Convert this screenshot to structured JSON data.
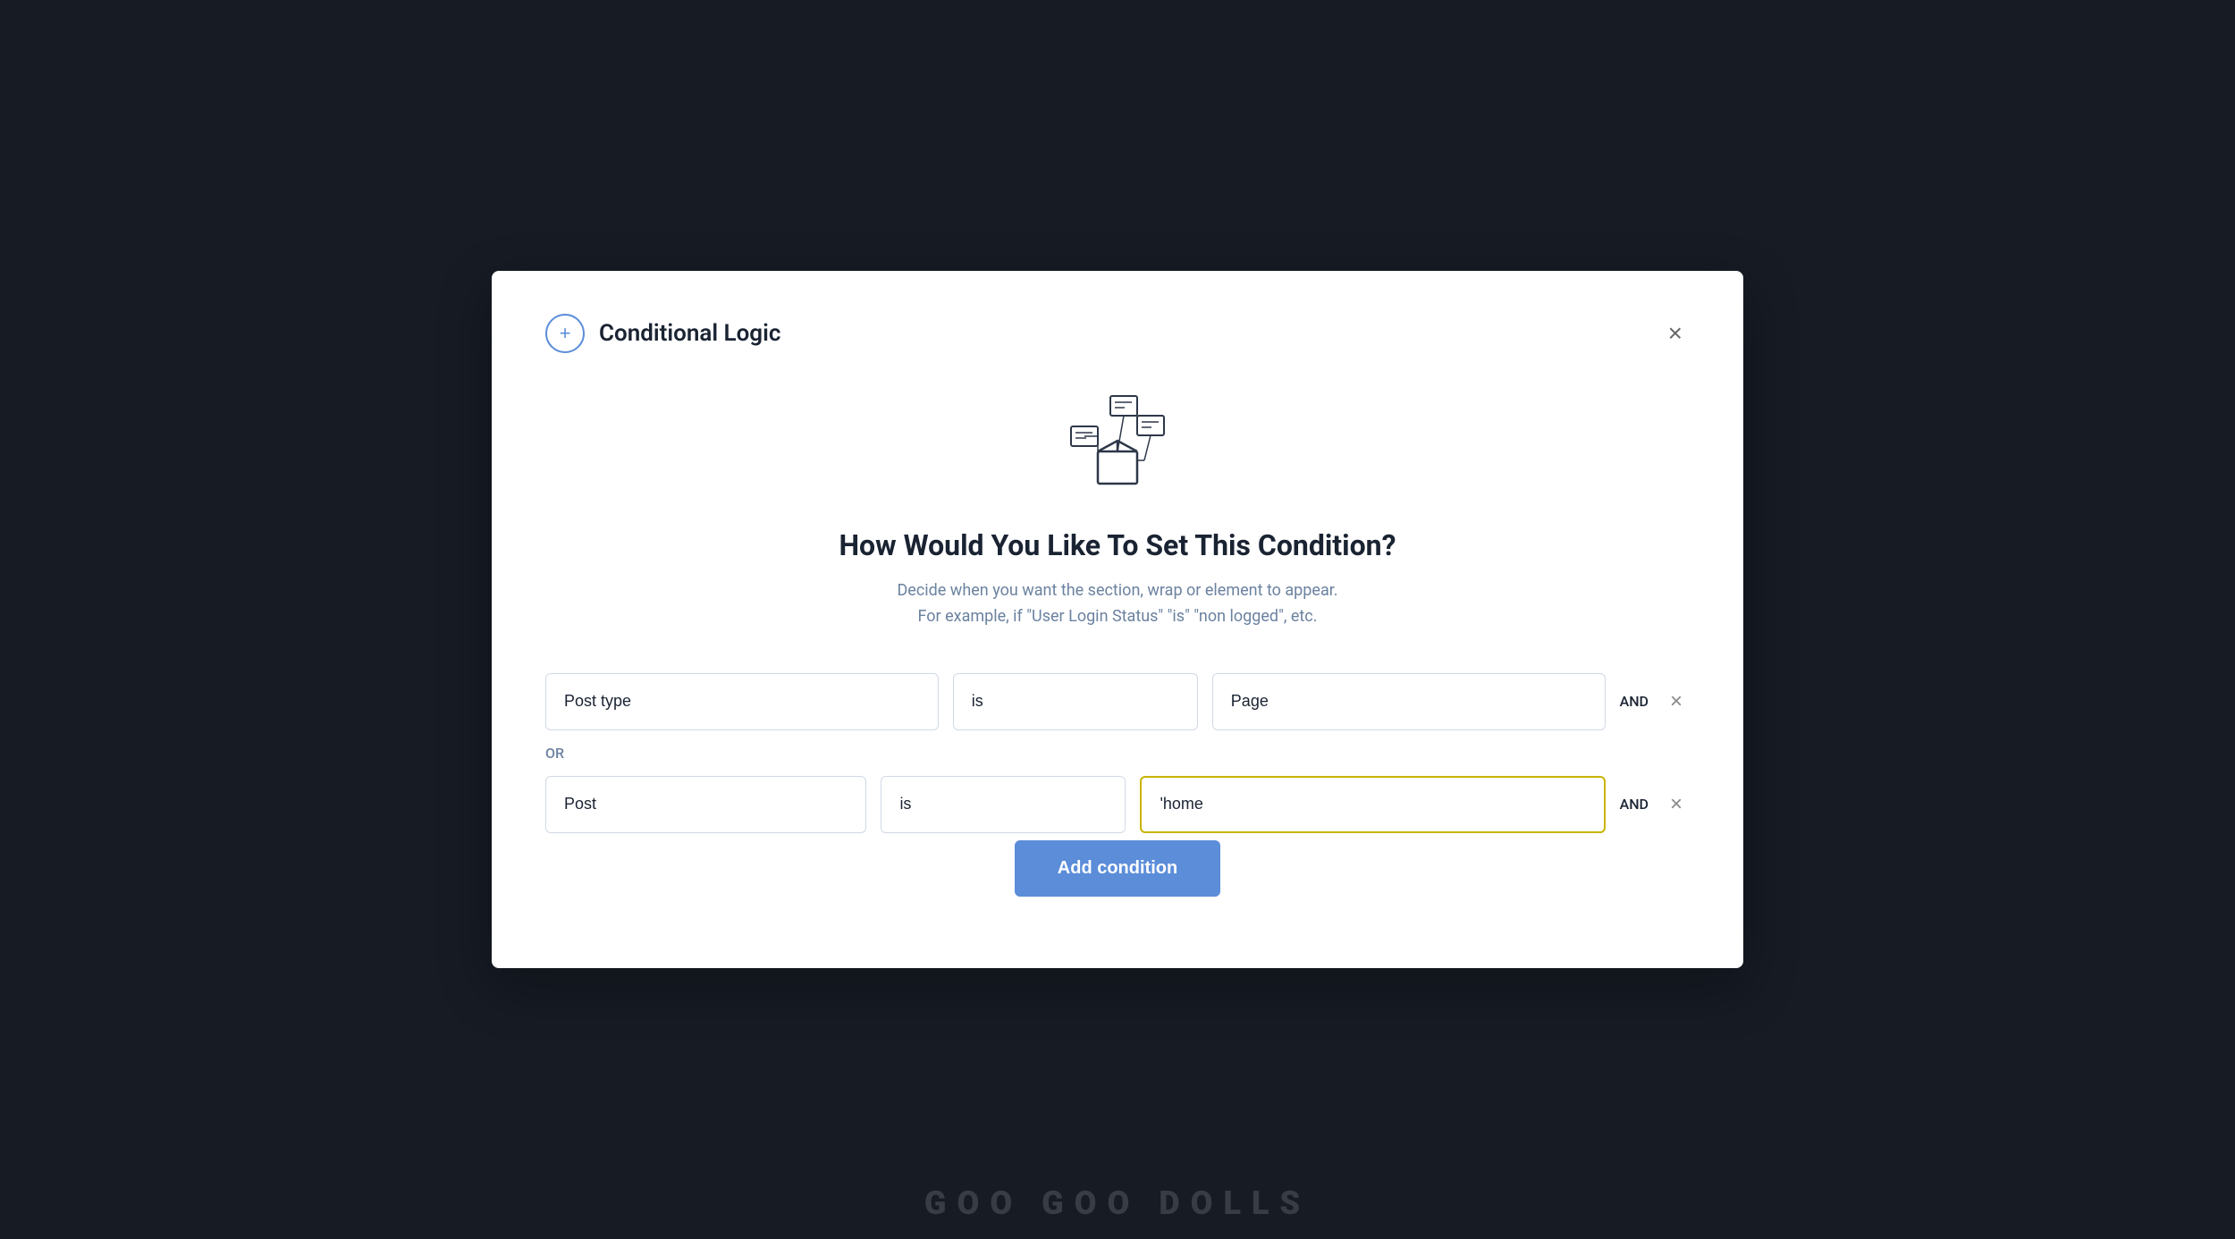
{
  "modal": {
    "title": "Conditional Logic",
    "close_label": "×",
    "plus_icon": "+",
    "heading": "How Would You Like To Set This Condition?",
    "subtext_line1": "Decide when you want the section, wrap or element to appear.",
    "subtext_line2": "For example, if \"User Login Status\" \"is\" \"non logged\", etc.",
    "add_condition_label": "Add condition"
  },
  "condition_rows": [
    {
      "field1_value": "Post type",
      "field2_value": "is",
      "field3_value": "Page",
      "and_label": "AND",
      "remove_label": "×",
      "is_active": false
    },
    {
      "field1_value": "Post",
      "field2_value": "is",
      "field3_value": "'home",
      "and_label": "AND",
      "remove_label": "×",
      "is_active": true
    }
  ],
  "or_label": "OR",
  "bottom_text": "GOO GOO DOLLS"
}
